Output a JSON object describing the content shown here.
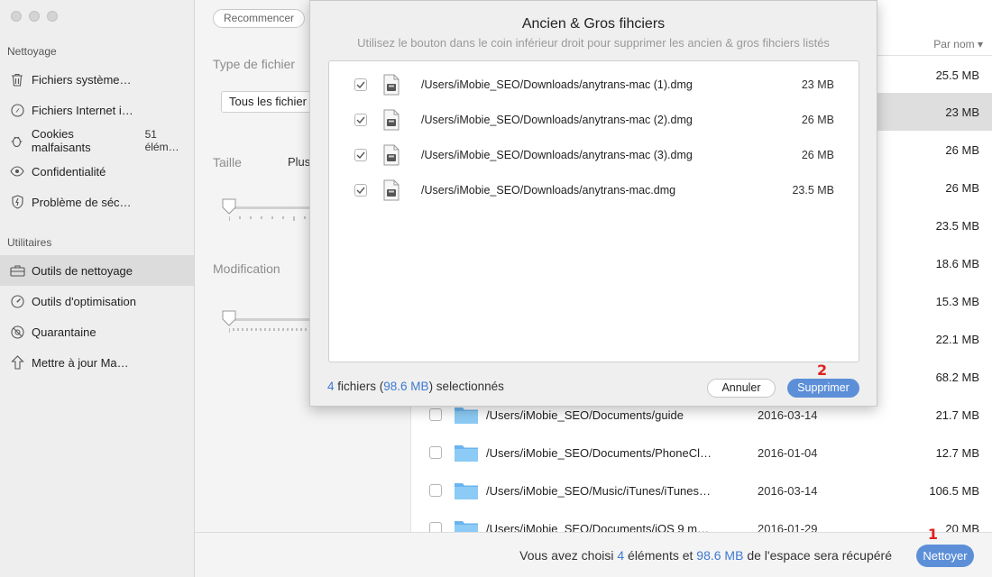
{
  "sidebar": {
    "sections": [
      {
        "title": "Nettoyage",
        "items": [
          {
            "label": "Fichiers système…",
            "icon": "trash-icon"
          },
          {
            "label": "Fichiers Internet i…",
            "icon": "compass-icon"
          },
          {
            "label": "Cookies malfaisants",
            "icon": "bug-icon",
            "count": "51 élém…"
          },
          {
            "label": "Confidentialité",
            "icon": "eye-icon"
          },
          {
            "label": "Problème de séc…",
            "icon": "shield-icon"
          }
        ]
      },
      {
        "title": "Utilitaires",
        "items": [
          {
            "label": "Outils de nettoyage",
            "icon": "toolbox-icon",
            "active": true
          },
          {
            "label": "Outils d'optimisation",
            "icon": "gauge-icon"
          },
          {
            "label": "Quarantaine",
            "icon": "quarantine-icon"
          },
          {
            "label": "Mettre à jour Ma…",
            "icon": "update-arrow-icon"
          }
        ]
      }
    ]
  },
  "filter": {
    "restart_label": "Recommencer",
    "type_label": "Type de fichier",
    "type_value": "Tous les fichier",
    "size_label": "Taille",
    "size_value": "Plus",
    "modified_label": "Modification"
  },
  "list": {
    "sort_label": "Par nom",
    "rows": [
      {
        "path": "",
        "date": "",
        "size": "25.5 MB"
      },
      {
        "path": "",
        "date": "",
        "size": "23 MB",
        "highlight": true
      },
      {
        "path": "",
        "date": "",
        "size": "26 MB"
      },
      {
        "path": "",
        "date": "",
        "size": "26 MB"
      },
      {
        "path": "",
        "date": "",
        "size": "23.5 MB"
      },
      {
        "path": "",
        "date": "",
        "size": "18.6 MB"
      },
      {
        "path": "",
        "date": "",
        "size": "15.3 MB"
      },
      {
        "path": "",
        "date": "",
        "size": "22.1 MB"
      },
      {
        "path": "",
        "date": "",
        "size": "68.2 MB"
      },
      {
        "path": "/Users/iMobie_SEO/Documents/guide",
        "date": "2016-03-14",
        "size": "21.7 MB"
      },
      {
        "path": "/Users/iMobie_SEO/Documents/PhoneCle…",
        "date": "2016-01-04",
        "size": "12.7 MB"
      },
      {
        "path": "/Users/iMobie_SEO/Music/iTunes/iTunes…",
        "date": "2016-03-14",
        "size": "106.5 MB"
      },
      {
        "path": "/Users/iMobie_SEO/Documents/iOS 9 mo…",
        "date": "2016-01-29",
        "size": "20 MB"
      }
    ]
  },
  "footer": {
    "text_1": "Vous avez choisi ",
    "count": "4",
    "text_2": " éléments et ",
    "size": "98.6 MB",
    "text_3": " de l'espace sera récupéré",
    "clean_label": "Nettoyer",
    "marker": "1"
  },
  "modal": {
    "title": "Ancien & Gros fihciers",
    "subtitle": "Utilisez le bouton dans le coin inférieur droit pour supprimer les ancien & gros fihciers listés",
    "files": [
      {
        "path": "/Users/iMobie_SEO/Downloads/anytrans-mac (1).dmg",
        "size": "23 MB",
        "checked": true
      },
      {
        "path": "/Users/iMobie_SEO/Downloads/anytrans-mac (2).dmg",
        "size": "26 MB",
        "checked": true
      },
      {
        "path": "/Users/iMobie_SEO/Downloads/anytrans-mac (3).dmg",
        "size": "26 MB",
        "checked": true
      },
      {
        "path": "/Users/iMobie_SEO/Downloads/anytrans-mac.dmg",
        "size": "23.5 MB",
        "checked": true
      }
    ],
    "summary_count": "4",
    "summary_text_1": " fichiers (",
    "summary_size": "98.6 MB",
    "summary_text_2": ") selectionnés",
    "cancel_label": "Annuler",
    "delete_label": "Supprimer",
    "marker": "2"
  },
  "colors": {
    "accent": "#5d8fd8",
    "link": "#3f79d1",
    "marker": "#e02020"
  }
}
